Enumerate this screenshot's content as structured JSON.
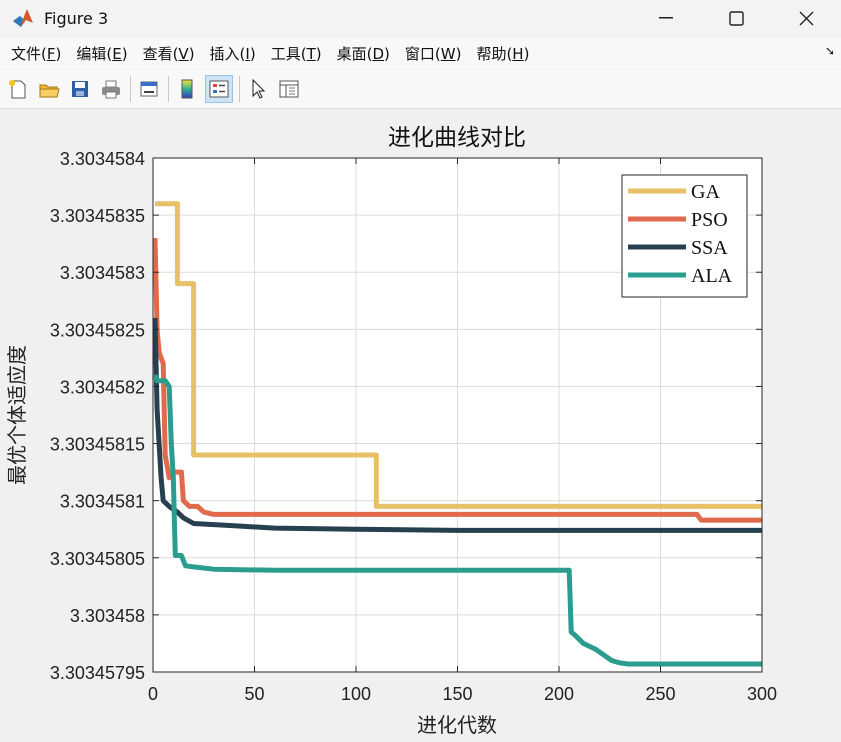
{
  "window": {
    "title": "Figure 3",
    "controls": {
      "minimize": "—",
      "maximize": "☐",
      "close": "✕"
    }
  },
  "menu": [
    {
      "label": "文件(",
      "key": "F",
      "tail": ")"
    },
    {
      "label": "编辑(",
      "key": "E",
      "tail": ")"
    },
    {
      "label": "查看(",
      "key": "V",
      "tail": ")"
    },
    {
      "label": "插入(",
      "key": "I",
      "tail": ")"
    },
    {
      "label": "工具(",
      "key": "T",
      "tail": ")"
    },
    {
      "label": "桌面(",
      "key": "D",
      "tail": ")"
    },
    {
      "label": "窗口(",
      "key": "W",
      "tail": ")"
    },
    {
      "label": "帮助(",
      "key": "H",
      "tail": ")"
    }
  ],
  "toolbar_icons": [
    "new-file-icon",
    "open-folder-icon",
    "save-icon",
    "print-icon",
    "link-plot-icon",
    "colorbar-icon",
    "legend-icon",
    "pointer-icon",
    "property-inspector-icon"
  ],
  "chart_data": {
    "type": "line",
    "title": "进化曲线对比",
    "xlabel": "进化代数",
    "ylabel": "最优个体适应度",
    "xlim": [
      0,
      300
    ],
    "ylim": [
      3.30345795,
      3.3034584
    ],
    "xticks": [
      0,
      50,
      100,
      150,
      200,
      250,
      300
    ],
    "xtick_labels": [
      "0",
      "50",
      "100",
      "150",
      "200",
      "250",
      "300"
    ],
    "yticks": [
      3.30345795,
      3.303458,
      3.30345805,
      3.3034581,
      3.30345815,
      3.3034582,
      3.30345825,
      3.3034583,
      3.30345835,
      3.3034584
    ],
    "ytick_labels": [
      "3.30345795",
      "3.303458",
      "3.30345805",
      "3.3034581",
      "3.30345815",
      "3.3034582",
      "3.30345825",
      "3.3034583",
      "3.30345835",
      "3.3034584"
    ],
    "grid": true,
    "legend_position": "top-right",
    "series": [
      {
        "name": "GA",
        "color": "#E8C066",
        "x": [
          1,
          12,
          12,
          20,
          20,
          110,
          110,
          300
        ],
        "y": [
          3.30345836,
          3.30345836,
          3.30345829,
          3.30345829,
          3.30345814,
          3.30345814,
          3.303458095,
          3.303458095
        ]
      },
      {
        "name": "PSO",
        "color": "#E06A4C",
        "x": [
          1,
          2,
          3,
          5,
          6,
          8,
          10,
          14,
          15,
          18,
          22,
          25,
          30,
          268,
          270,
          300
        ],
        "y": [
          3.30345833,
          3.30345825,
          3.30345823,
          3.30345822,
          3.30345814,
          3.30345812,
          3.303458125,
          3.303458125,
          3.3034581,
          3.303458095,
          3.303458095,
          3.30345809,
          3.303458088,
          3.303458088,
          3.303458083,
          3.303458083
        ]
      },
      {
        "name": "SSA",
        "color": "#26404F",
        "x": [
          1,
          2,
          3,
          4,
          5,
          8,
          12,
          15,
          20,
          40,
          60,
          100,
          150,
          300
        ],
        "y": [
          3.30345826,
          3.30345818,
          3.30345815,
          3.30345812,
          3.3034581,
          3.303458095,
          3.30345809,
          3.303458085,
          3.30345808,
          3.303458078,
          3.303458076,
          3.303458075,
          3.303458074,
          3.303458074
        ]
      },
      {
        "name": "ALA",
        "color": "#2A9D8F",
        "x": [
          1,
          2,
          4,
          6,
          8,
          9,
          10,
          11,
          14,
          16,
          20,
          30,
          60,
          150,
          205,
          206,
          208,
          212,
          218,
          222,
          226,
          230,
          234,
          300
        ],
        "y": [
          3.30345821,
          3.303458205,
          3.303458205,
          3.303458205,
          3.3034582,
          3.30345815,
          3.30345812,
          3.303458052,
          3.303458052,
          3.303458043,
          3.303458042,
          3.30345804,
          3.303458039,
          3.303458039,
          3.303458039,
          3.303457985,
          3.303457982,
          3.303457975,
          3.30345797,
          3.303457965,
          3.30345796,
          3.303457958,
          3.303457957,
          3.303457957
        ]
      }
    ]
  }
}
